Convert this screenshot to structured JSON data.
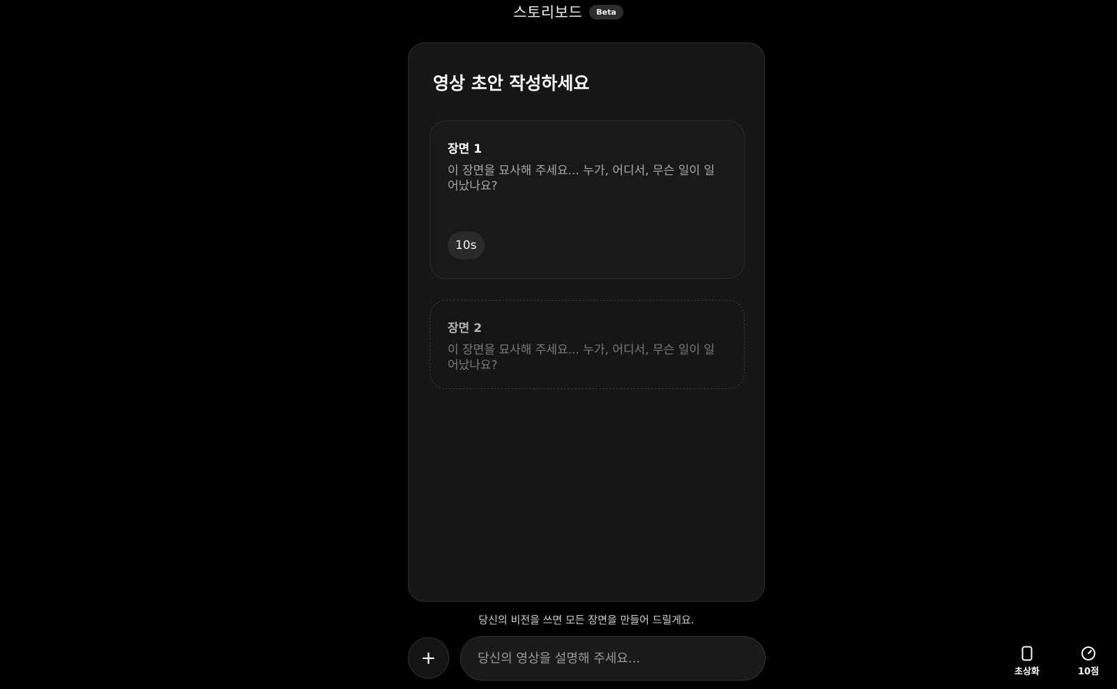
{
  "header": {
    "title": "스토리보드",
    "badge": "Beta"
  },
  "panel": {
    "title": "영상 초안 작성하세요",
    "scenes": [
      {
        "label": "장면 1",
        "placeholder": "이 장면을 묘사해 주세요... 누가, 어디서, 무슨 일이 일어났나요?",
        "duration": "10s"
      },
      {
        "label": "장면 2",
        "placeholder": "이 장면을 묘사해 주세요... 누가, 어디서, 무슨 일이 일어났나요?"
      }
    ]
  },
  "composer": {
    "hint": "당신의 비전을 쓰면 모든 장면을 만들어 드릴게요.",
    "add_symbol": "+",
    "input_placeholder": "당신의 영상을 설명해 주세요..."
  },
  "tools": {
    "orientation": {
      "label": "초상화",
      "icon": "phone-portrait-icon"
    },
    "duration": {
      "label": "10점",
      "icon": "timer-icon"
    }
  }
}
